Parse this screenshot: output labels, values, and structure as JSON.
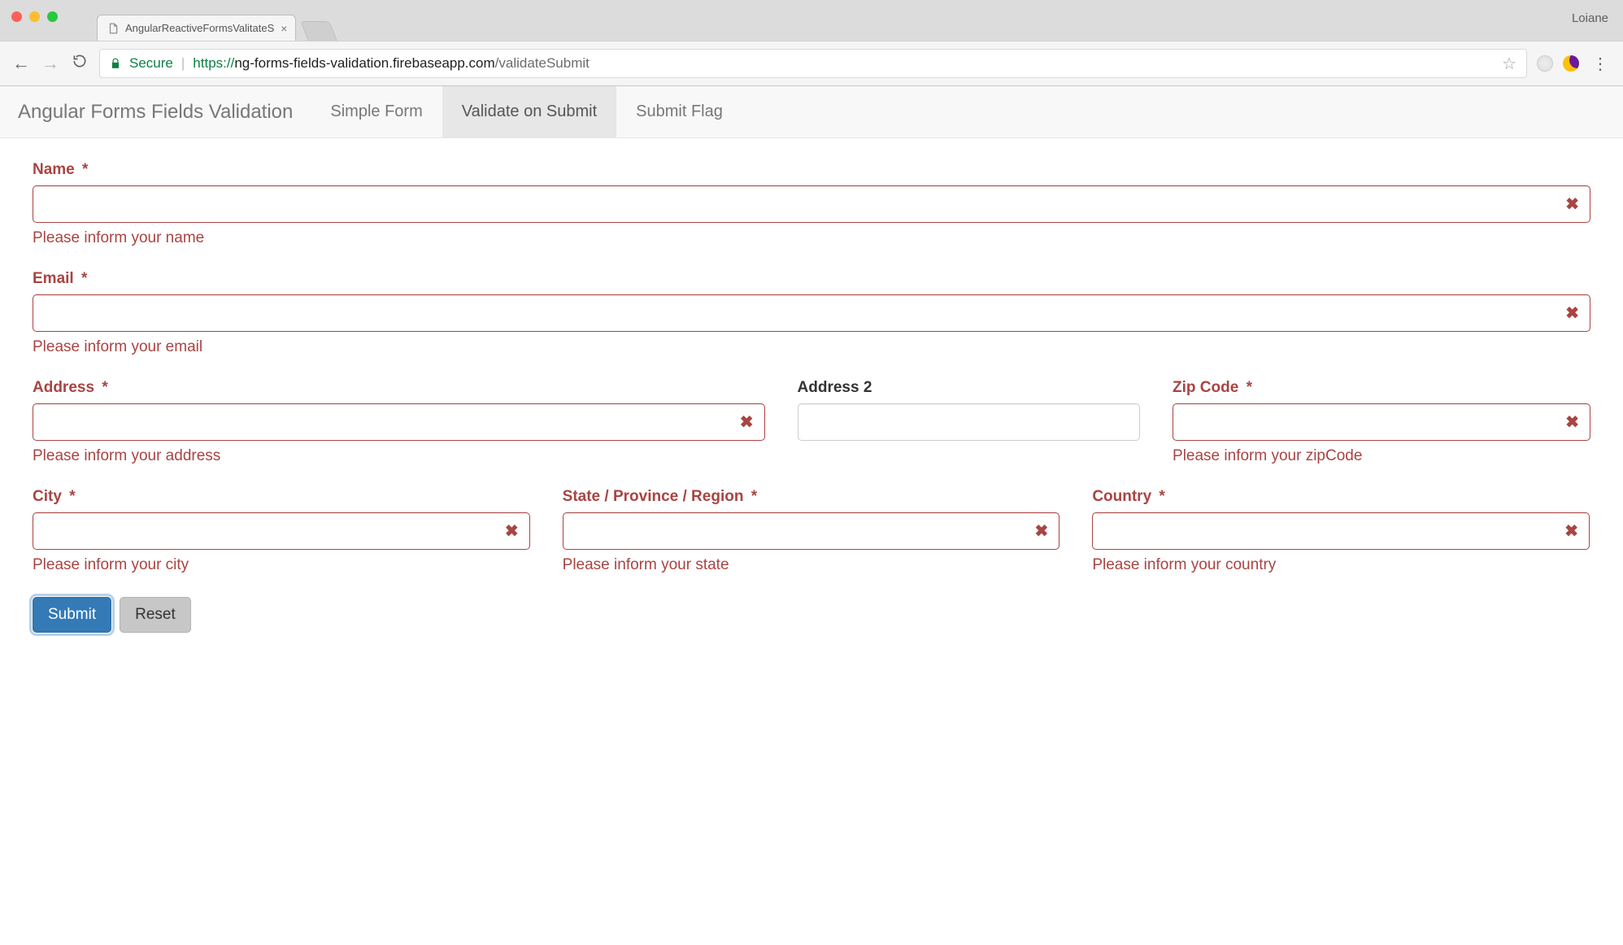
{
  "browser": {
    "tab_title": "AngularReactiveFormsValitateS",
    "profile": "Loiane",
    "secure_label": "Secure",
    "url_protocol": "https://",
    "url_host": "ng-forms-fields-validation.firebaseapp.com",
    "url_path": "/validateSubmit"
  },
  "navbar": {
    "brand": "Angular Forms Fields Validation",
    "items": [
      {
        "label": "Simple Form",
        "active": false
      },
      {
        "label": "Validate on Submit",
        "active": true
      },
      {
        "label": "Submit Flag",
        "active": false
      }
    ]
  },
  "form": {
    "name": {
      "label": "Name",
      "required": "*",
      "value": "",
      "error_msg": "Please inform your name",
      "invalid": true
    },
    "email": {
      "label": "Email",
      "required": "*",
      "value": "",
      "error_msg": "Please inform your email",
      "invalid": true
    },
    "address": {
      "label": "Address",
      "required": "*",
      "value": "",
      "error_msg": "Please inform your address",
      "invalid": true
    },
    "address2": {
      "label": "Address 2",
      "required": "",
      "value": "",
      "error_msg": "",
      "invalid": false
    },
    "zip": {
      "label": "Zip Code",
      "required": "*",
      "value": "",
      "error_msg": "Please inform your zipCode",
      "invalid": true
    },
    "city": {
      "label": "City",
      "required": "*",
      "value": "",
      "error_msg": "Please inform your city",
      "invalid": true
    },
    "state": {
      "label": "State / Province / Region",
      "required": "*",
      "value": "",
      "error_msg": "Please inform your state",
      "invalid": true
    },
    "country": {
      "label": "Country",
      "required": "*",
      "value": "",
      "error_msg": "Please inform your country",
      "invalid": true
    }
  },
  "buttons": {
    "submit": "Submit",
    "reset": "Reset"
  },
  "colors": {
    "error": "#a94442",
    "primary": "#337ab7",
    "navbar_bg": "#f8f8f8",
    "navbar_active_bg": "#e7e7e7"
  }
}
